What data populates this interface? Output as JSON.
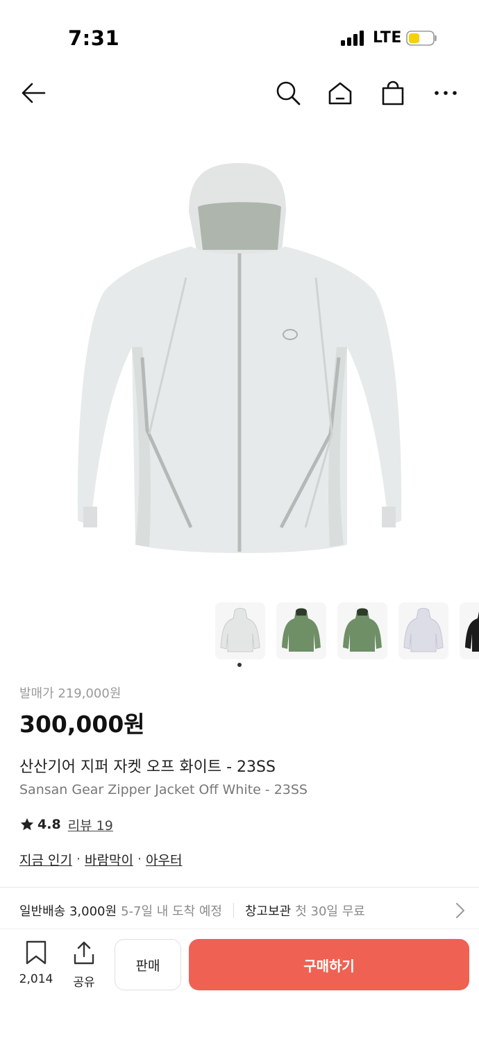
{
  "status_bar": {
    "time": "7:31",
    "network": "LTE",
    "battery_color": "#f5d10a"
  },
  "nav": {
    "back_icon": "arrow-left-icon",
    "search_icon": "search-icon",
    "home_icon": "home-icon",
    "cart_icon": "shopping-bag-icon",
    "more_icon": "more-horizontal-icon"
  },
  "product": {
    "image": "white-zipper-jacket",
    "thumbnails": [
      {
        "color": "#e4e6e6",
        "name": "off-white"
      },
      {
        "color": "#6f8f66",
        "name": "green"
      },
      {
        "color": "#6f8f66",
        "name": "green"
      },
      {
        "color": "#dcdde6",
        "name": "light-lavender"
      },
      {
        "color": "#1c1c1c",
        "name": "black"
      }
    ],
    "release_price": "발매가 219,000원",
    "price": "300,000원",
    "name_ko": "산산기어 지퍼 자켓 오프 화이트 - 23SS",
    "name_en": "Sansan Gear Zipper Jacket Off White - 23SS",
    "rating": "4.8",
    "reviews": "리뷰 19",
    "tags": [
      "지금 인기",
      "바람막이",
      "아우터"
    ],
    "tag_separator": "·"
  },
  "shipping": {
    "standard_label": "일반배송 3,000원",
    "standard_eta": "5-7일 내 도착 예정",
    "storage_label": "창고보관",
    "storage_detail": "첫 30일 무료"
  },
  "bottom_bar": {
    "wish_count": "2,014",
    "share_label": "공유",
    "sell_label": "판매",
    "buy_label": "구매하기",
    "buy_color": "#ef6253"
  }
}
